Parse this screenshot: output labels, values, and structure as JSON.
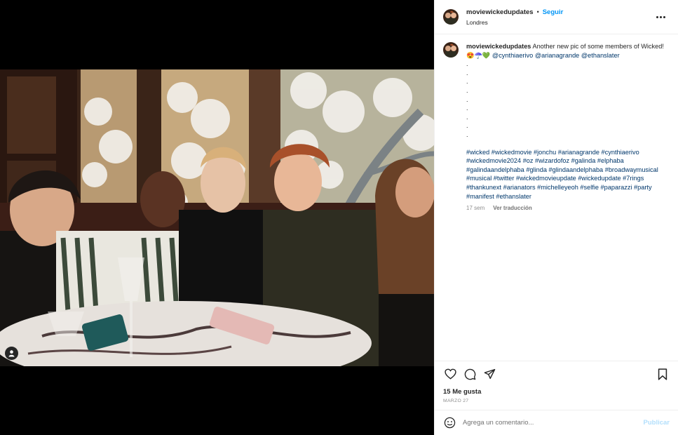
{
  "header": {
    "username": "moviewickedupdates",
    "dot": "•",
    "follow_label": "Seguir",
    "location": "Londres",
    "more_icon": "more-horizontal-icon"
  },
  "caption": {
    "username": "moviewickedupdates",
    "text": "Another new pic of some members of Wicked! 😍☂️💚",
    "mentions": [
      "@cynthiaerivo",
      "@arianagrande",
      "@ethanslater"
    ],
    "dots": [
      ".",
      ".",
      ".",
      ".",
      ".",
      ".",
      ".",
      ".",
      "."
    ],
    "hashtags": "#wicked #wickedmovie #jonchu #arianagrande #cynthiaerivo #wickedmovie2024 #oz #wizardofoz #galinda #elphaba #galindaandelphaba #glinda #glindaandelphaba #broadwaymusical #musical #twitter #wickedmovieupdate #wickedupdate #7rings #thankunext #arianators #michelleyeoh #selfie #paparazzi #party #manifest #ethanslater",
    "time_ago": "17 sem",
    "translate_label": "Ver traducción"
  },
  "actions": {
    "icons": [
      "heart-icon",
      "comment-icon",
      "share-icon",
      "bookmark-icon"
    ],
    "likes": "15 Me gusta",
    "date": "MARZO 27"
  },
  "comment": {
    "placeholder": "Agrega un comentario...",
    "publish_label": "Publicar",
    "emoji_icon": "emoji-icon"
  },
  "media": {
    "description_icon": "tagged-user-icon"
  }
}
